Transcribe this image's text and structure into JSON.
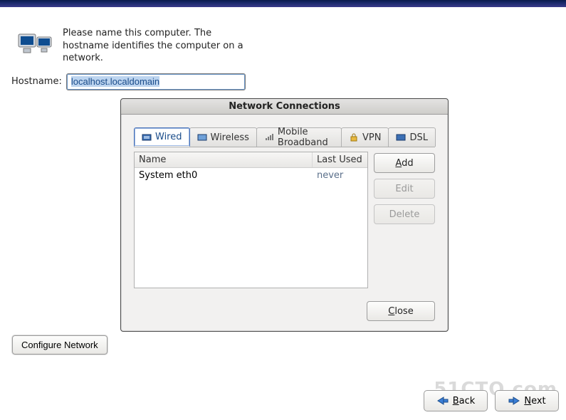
{
  "banner": {},
  "instruction": "Please name this computer.  The hostname identifies the computer on a network.",
  "hostname": {
    "label": "Hostname:",
    "value": "localhost.localdomain"
  },
  "dialog": {
    "title": "Network Connections",
    "tabs": [
      {
        "label": "Wired",
        "icon": "wired-icon",
        "active": true
      },
      {
        "label": "Wireless",
        "icon": "wireless-icon",
        "active": false
      },
      {
        "label": "Mobile Broadband",
        "icon": "mobile-icon",
        "active": false
      },
      {
        "label": "VPN",
        "icon": "vpn-icon",
        "active": false
      },
      {
        "label": "DSL",
        "icon": "dsl-icon",
        "active": false
      }
    ],
    "columns": {
      "name": "Name",
      "last": "Last Used"
    },
    "rows": [
      {
        "name": "System eth0",
        "last": "never"
      }
    ],
    "buttons": {
      "add": {
        "label": "Add",
        "mnemonic_index": 0,
        "enabled": true
      },
      "edit": {
        "label": "Edit",
        "mnemonic_index": -1,
        "enabled": false
      },
      "delete": {
        "label": "Delete",
        "mnemonic_index": -1,
        "enabled": false
      },
      "close": {
        "label": "Close",
        "mnemonic_index": 0
      }
    }
  },
  "configure_button": "Configure Network",
  "nav": {
    "back": {
      "label": "Back",
      "mnemonic_index": 0
    },
    "next": {
      "label": "Next",
      "mnemonic_index": 0
    }
  },
  "watermark": "51CTO.com"
}
